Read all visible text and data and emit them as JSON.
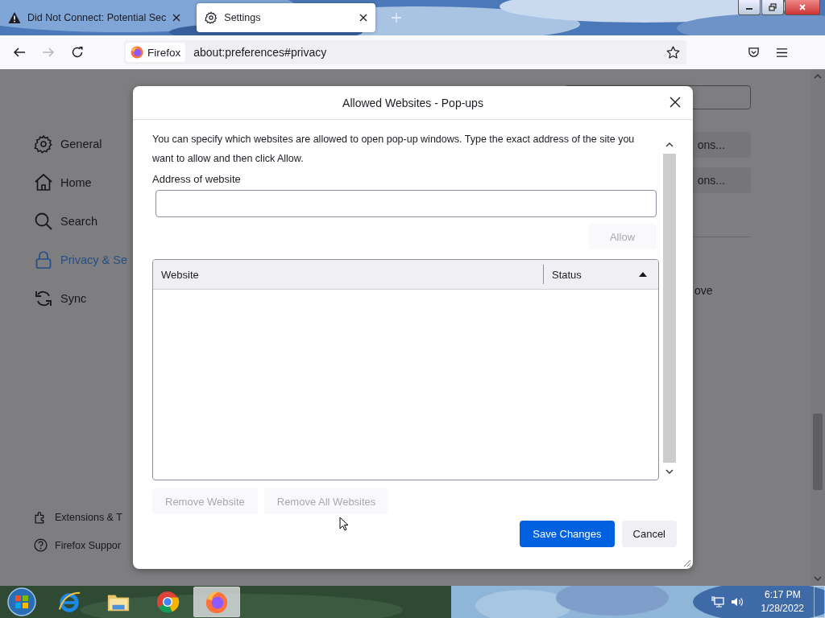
{
  "browser": {
    "tabs": [
      {
        "title": "Did Not Connect: Potential Sec",
        "selected": false
      },
      {
        "title": "Settings",
        "selected": true
      }
    ],
    "nav_buttons": [
      {
        "kind": "back",
        "disabled": false
      },
      {
        "kind": "forward",
        "disabled": true
      },
      {
        "kind": "reload",
        "disabled": false
      }
    ],
    "address_bar": {
      "identity": "Firefox",
      "url": "about:preferences#privacy"
    }
  },
  "sidebar": {
    "items": [
      {
        "label": "General",
        "selected": false
      },
      {
        "label": "Home",
        "selected": false
      },
      {
        "label": "Search",
        "selected": false
      },
      {
        "label": "Privacy & Se",
        "selected": true
      },
      {
        "label": "Sync",
        "selected": false
      }
    ],
    "footer": [
      "Extensions & T",
      "Firefox Suppor"
    ]
  },
  "page_behind": {
    "buttons": [
      "ons...",
      "ons..."
    ],
    "text": "ove"
  },
  "dialog": {
    "title": "Allowed Websites - Pop-ups",
    "description": "You can specify which websites are allowed to open pop-up windows. Type the exact address of the site you want to allow and then click Allow.",
    "address_label": "Address of website",
    "allow_button": {
      "label": "Allow",
      "disabled": true
    },
    "table": {
      "columns": [
        {
          "label": "Website",
          "sorted": false
        },
        {
          "label": "Status",
          "sorted": true
        }
      ]
    },
    "remove_buttons": [
      {
        "label": "Remove Website",
        "disabled": true
      },
      {
        "label": "Remove All Websites",
        "disabled": true
      }
    ],
    "actions": [
      {
        "label": "Save Changes",
        "kind": "primary"
      },
      {
        "label": "Cancel",
        "kind": "secondary"
      }
    ]
  },
  "taskbar": {
    "apps": [
      {
        "kind": "ie",
        "selected": false
      },
      {
        "kind": "explorer",
        "selected": false
      },
      {
        "kind": "chrome",
        "selected": false
      },
      {
        "kind": "firefox",
        "selected": true
      }
    ],
    "clock": {
      "time": "6:17 PM",
      "date": "1/28/2022"
    }
  }
}
